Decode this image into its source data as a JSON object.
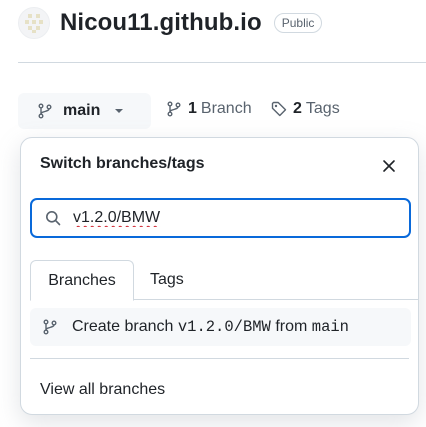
{
  "repo": {
    "name": "Nicou11.github.io",
    "visibility": "Public"
  },
  "branch_selector": {
    "current": "main"
  },
  "meta": {
    "branch_count": "1",
    "branch_label": "Branch",
    "tag_count": "2",
    "tag_label": "Tags"
  },
  "popover": {
    "title": "Switch branches/tags",
    "search_value": "v1.2.0/BMW",
    "tabs": [
      "Branches",
      "Tags"
    ],
    "create_branch": {
      "prefix": "Create branch",
      "name": "v1.2.0/BMW",
      "from_word": "from",
      "source": "main"
    },
    "view_all": "View all branches"
  },
  "icons": {
    "avatar": "identicon-avatar",
    "branch": "git-branch-icon",
    "tag": "tag-icon",
    "search": "search-icon",
    "close": "close-icon",
    "caret": "triangle-down-icon"
  },
  "colors": {
    "accent": "#0969da",
    "muted": "#59636e",
    "text": "#1f2328",
    "border": "#d1d9e0"
  }
}
